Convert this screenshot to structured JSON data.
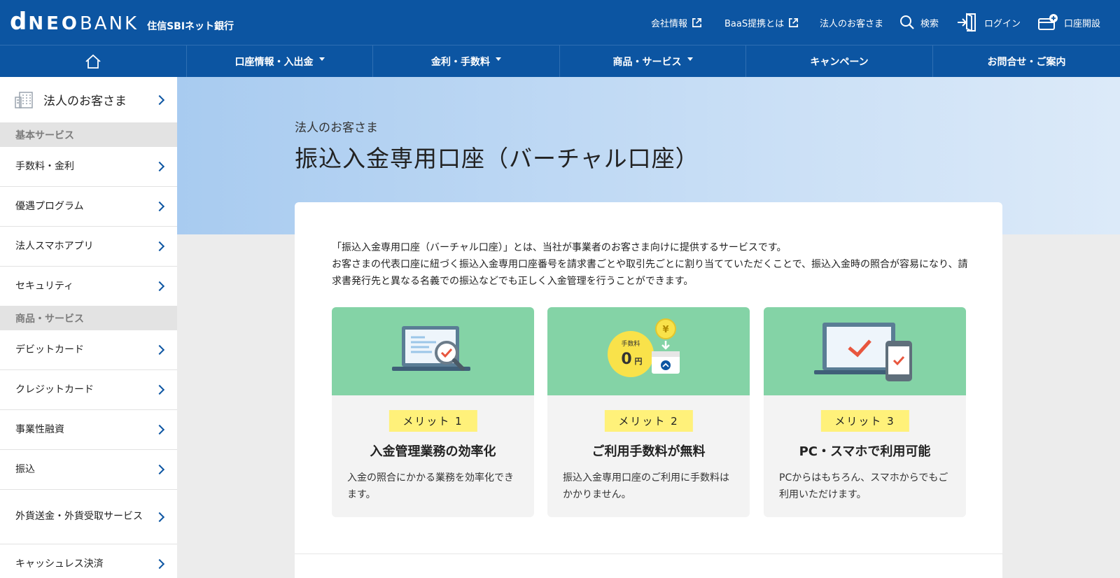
{
  "header": {
    "logo_d": "d",
    "logo_neo": "NEO",
    "logo_bank": "BANK",
    "logo_sub": "住信SBIネット銀行",
    "links": {
      "company": "会社情報",
      "baas": "BaaS提携とは",
      "corporate": "法人のお客さま",
      "search": "検索",
      "login": "ログイン",
      "open_account": "口座開設"
    }
  },
  "nav": {
    "home_icon": "home-icon",
    "items": [
      {
        "label": "口座情報・入出金",
        "dropdown": true
      },
      {
        "label": "金利・手数料",
        "dropdown": true
      },
      {
        "label": "商品・サービス",
        "dropdown": true
      },
      {
        "label": "キャンペーン",
        "dropdown": false
      },
      {
        "label": "お問合せ・ご案内",
        "dropdown": false
      }
    ]
  },
  "sidebar": {
    "top": {
      "label": "法人のお客さま",
      "icon": "building-icon"
    },
    "sections": [
      {
        "title": "基本サービス",
        "items": [
          "手数料・金利",
          "優遇プログラム",
          "法人スマホアプリ",
          "セキュリティ"
        ]
      },
      {
        "title": "商品・サービス",
        "items": [
          "デビットカード",
          "クレジットカード",
          "事業性融資",
          "振込",
          "外貨送金・外貨受取サービス",
          "キャッシュレス決済"
        ]
      }
    ]
  },
  "page": {
    "breadcrumb": "法人のお客さま",
    "title": "振込入金専用口座（バーチャル口座）",
    "intro_1": "「振込入金専用口座（バーチャル口座）」とは、当社が事業者のお客さま向けに提供するサービスです。",
    "intro_2": "お客さまの代表口座に紐づく振込入金専用口座番号を請求書ごとや取引先ごとに割り当てていただくことで、振込入金時の照合が容易になり、請求書発行先と異なる名義での振込などでも正しく入金管理を行うことができます。"
  },
  "merits": [
    {
      "badge": "メリット 1",
      "title": "入金管理業務の効率化",
      "text": "入金の照合にかかる業務を効率化できます。",
      "icon": "laptop-magnifier-icon"
    },
    {
      "badge": "メリット 2",
      "title": "ご利用手数料が無料",
      "text": "振込入金専用口座のご利用に手数料はかかりません。",
      "icon": "fee-zero-icon",
      "fee_label": "手数料",
      "fee_value": "0",
      "fee_unit": "円",
      "coin_symbol": "¥"
    },
    {
      "badge": "メリット 3",
      "title": "PC・スマホで利用可能",
      "text": "PCからはもちろん、スマホからでもご利用いただけます。",
      "icon": "pc-smartphone-icon"
    }
  ],
  "colors": {
    "brand_blue": "#0c55a2",
    "merit_green": "#84d3a6",
    "badge_yellow": "#fff17a",
    "check_red": "#e8563e"
  }
}
